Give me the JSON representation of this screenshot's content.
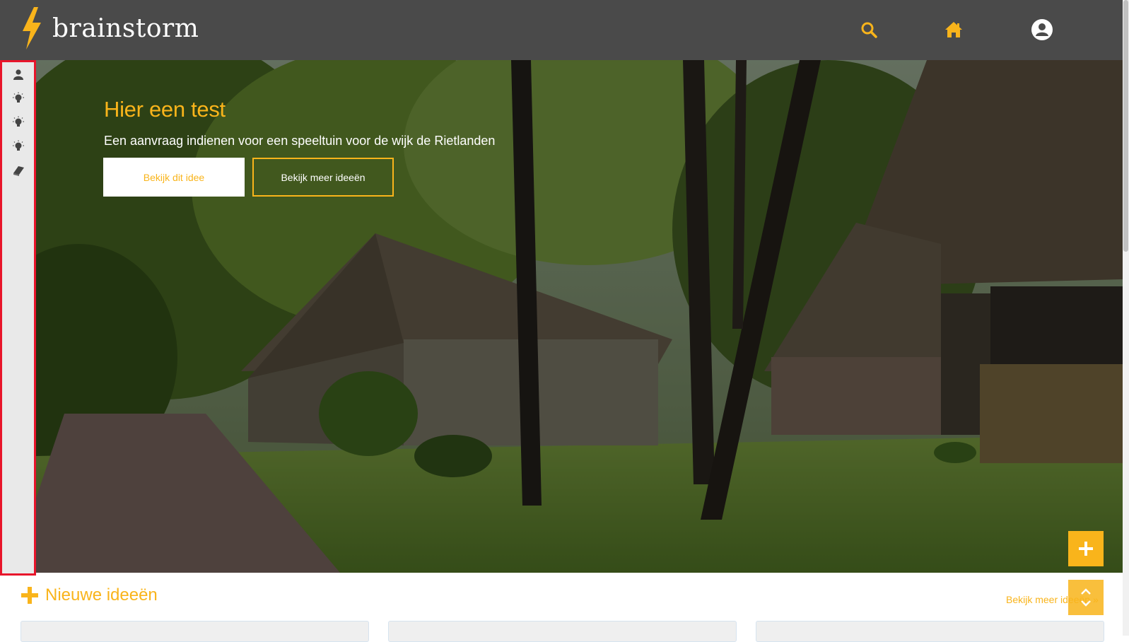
{
  "brand": {
    "name": "brainstorm"
  },
  "header": {
    "icons": [
      "search-icon",
      "home-icon",
      "user-avatar-icon"
    ]
  },
  "sidebar": {
    "items": [
      {
        "icon": "user-icon"
      },
      {
        "icon": "lightbulb-icon"
      },
      {
        "icon": "lightbulb-icon"
      },
      {
        "icon": "lightbulb-icon"
      },
      {
        "icon": "book-icon"
      }
    ]
  },
  "hero": {
    "title": "Hier een test",
    "subtitle": "Een aanvraag indienen voor een speeltuin voor de wijk de Rietlanden",
    "primary_button": "Bekijk dit idee",
    "secondary_button": "Bekijk meer ideeën"
  },
  "new_ideas": {
    "title": "Nieuwe ideeën",
    "more_link": "Bekijk meer ideeën »"
  },
  "colors": {
    "accent": "#f9b41b",
    "header_bg": "#4a4a4a",
    "sidebar_bg": "#e9e9e9",
    "highlight_border": "#e8152b"
  }
}
